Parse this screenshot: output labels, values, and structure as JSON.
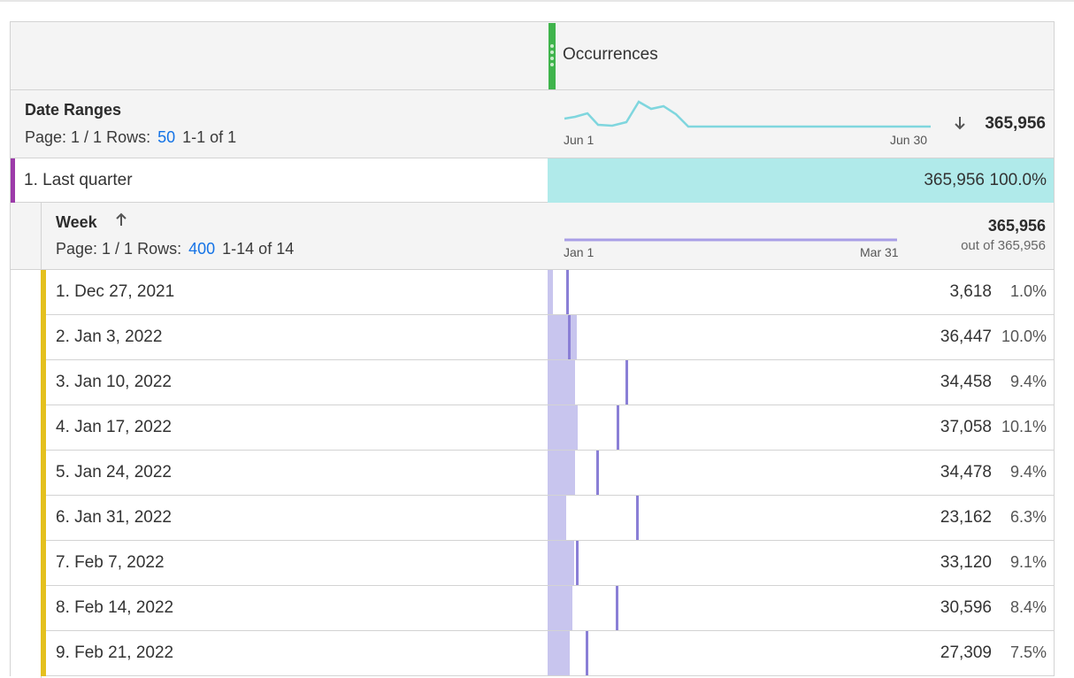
{
  "header": {
    "metric_title": "Occurrences"
  },
  "date_ranges": {
    "title": "Date Ranges",
    "page_label": "Page: 1 / 1",
    "rows_label": "Rows:",
    "rows_value": "50",
    "range_label": "1-1 of 1",
    "spark_start": "Jun 1",
    "spark_end": "Jun 30",
    "sort_icon": "arrow-down-icon",
    "total": "365,956",
    "spark_color": "#7fd6de"
  },
  "last_quarter": {
    "label": "1.  Last quarter",
    "value": "365,956",
    "percent": "100.0%",
    "fill_fraction": 1.0
  },
  "week": {
    "title": "Week",
    "sort_icon": "arrow-up-icon",
    "page_label": "Page: 1 / 1",
    "rows_label": "Rows:",
    "rows_value": "400",
    "range_label": "1-14 of 14",
    "spark_start": "Jan 1",
    "spark_end": "Mar 31",
    "total": "365,956",
    "out_of": "out of 365,956",
    "spark_color": "#a89ee6"
  },
  "rows": [
    {
      "label": "1.  Dec 27, 2021",
      "value": "3,618",
      "percent": "1.0%",
      "fraction": 0.01
    },
    {
      "label": "2.  Jan 3, 2022",
      "value": "36,447",
      "percent": "10.0%",
      "fraction": 0.1
    },
    {
      "label": "3.  Jan 10, 2022",
      "value": "34,458",
      "percent": "9.4%",
      "fraction": 0.094
    },
    {
      "label": "4.  Jan 17, 2022",
      "value": "37,058",
      "percent": "10.1%",
      "fraction": 0.101
    },
    {
      "label": "5.  Jan 24, 2022",
      "value": "34,478",
      "percent": "9.4%",
      "fraction": 0.094
    },
    {
      "label": "6.  Jan 31, 2022",
      "value": "23,162",
      "percent": "6.3%",
      "fraction": 0.063
    },
    {
      "label": "7.  Feb 7, 2022",
      "value": "33,120",
      "percent": "9.1%",
      "fraction": 0.091
    },
    {
      "label": "8.  Feb 14, 2022",
      "value": "30,596",
      "percent": "8.4%",
      "fraction": 0.084
    },
    {
      "label": "9.  Feb 21, 2022",
      "value": "27,309",
      "percent": "7.5%",
      "fraction": 0.075
    }
  ]
}
